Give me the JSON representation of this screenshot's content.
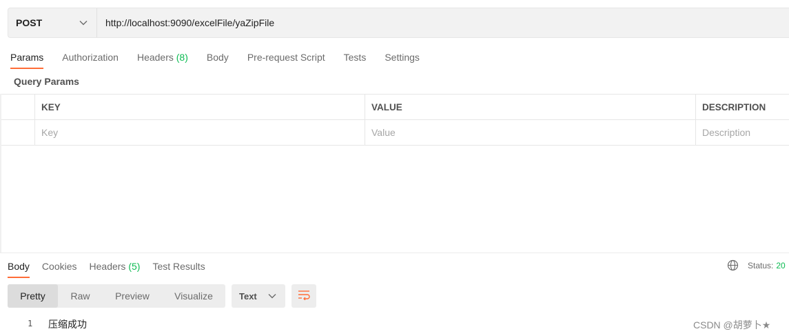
{
  "request": {
    "method": "POST",
    "url": "http://localhost:9090/excelFile/yaZipFile"
  },
  "request_tabs": [
    {
      "label": "Params",
      "count": "",
      "active": true
    },
    {
      "label": "Authorization",
      "count": "",
      "active": false
    },
    {
      "label": "Headers",
      "count": "(8)",
      "active": false
    },
    {
      "label": "Body",
      "count": "",
      "active": false
    },
    {
      "label": "Pre-request Script",
      "count": "",
      "active": false
    },
    {
      "label": "Tests",
      "count": "",
      "active": false
    },
    {
      "label": "Settings",
      "count": "",
      "active": false
    }
  ],
  "query_params": {
    "title": "Query Params",
    "headers": {
      "key": "KEY",
      "value": "VALUE",
      "description": "DESCRIPTION"
    },
    "placeholders": {
      "key": "Key",
      "value": "Value",
      "description": "Description"
    }
  },
  "response_tabs": [
    {
      "label": "Body",
      "count": "",
      "active": true
    },
    {
      "label": "Cookies",
      "count": "",
      "active": false
    },
    {
      "label": "Headers",
      "count": "(5)",
      "active": false
    },
    {
      "label": "Test Results",
      "count": "",
      "active": false
    }
  ],
  "status": {
    "label": "Status:",
    "value": "20"
  },
  "format_modes": [
    "Pretty",
    "Raw",
    "Preview",
    "Visualize"
  ],
  "format_active": "Pretty",
  "language": "Text",
  "body_lines": [
    {
      "number": "1",
      "text": "压缩成功"
    }
  ],
  "watermark": "CSDN @胡萝卜★",
  "colors": {
    "accent": "#ff6c37",
    "success": "#0cbb52"
  }
}
